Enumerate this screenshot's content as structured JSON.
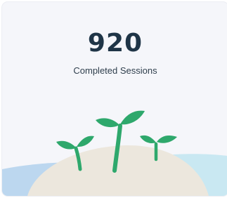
{
  "stat": {
    "value": "920",
    "label": "Completed Sessions"
  },
  "colors": {
    "card_background": "#f5f6fa",
    "value_text": "#1f3547",
    "label_text": "#2e3e4c",
    "water_left": "#bcd7ef",
    "water_right": "#c9e8f2",
    "mound": "#ece7dd",
    "sprout_leaf": "#2ea86c",
    "sprout_stem": "#2ea86c"
  },
  "illustration": {
    "icons": [
      "ground-mound-icon",
      "sprout-icon",
      "sprout-icon",
      "sprout-icon"
    ]
  }
}
